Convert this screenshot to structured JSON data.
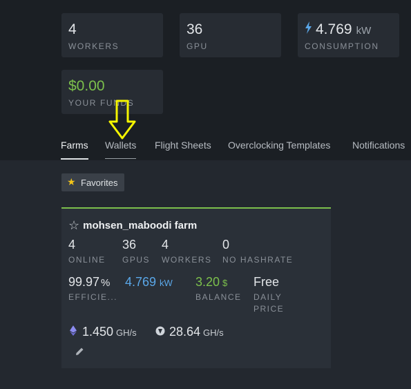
{
  "stats": [
    {
      "value": "4",
      "label": "WORKERS"
    },
    {
      "value": "36",
      "label": "GPU"
    },
    {
      "icon": "lightning-icon",
      "value": "4.769",
      "unit": "kW",
      "label": "CONSUMPTION"
    },
    {
      "value": "$0.00",
      "label": "YOUR FUNDS",
      "value_color": "#7cc04c"
    }
  ],
  "tabs": [
    {
      "label": "Farms",
      "active": true
    },
    {
      "label": "Wallets",
      "hover": true
    },
    {
      "label": "Flight Sheets"
    },
    {
      "label": "Overclocking Templates"
    },
    {
      "label": "Notifications"
    }
  ],
  "favorites_button": "Favorites",
  "farm": {
    "name": "mohsen_maboodi farm",
    "metrics": [
      {
        "value": "4",
        "label": "ONLINE"
      },
      {
        "value": "36",
        "label": "GPUS"
      },
      {
        "value": "4",
        "label": "WORKERS"
      },
      {
        "value": "0",
        "label": "NO HASHRATE"
      }
    ],
    "efficiency": {
      "value": "99.97",
      "unit": "%",
      "label": "EFFICIE..."
    },
    "power": {
      "value": "4.769",
      "unit": "kW"
    },
    "balance": {
      "value": "3.20",
      "unit": "$",
      "label": "BALANCE"
    },
    "daily_price": {
      "value": "Free",
      "label_line1": "DAILY",
      "label_line2": "PRICE"
    },
    "hashrates": [
      {
        "coin_icon": "ethereum-icon",
        "value": "1.450",
        "unit": "GH/s"
      },
      {
        "coin_icon": "ravencoin-icon",
        "value": "28.64",
        "unit": "GH/s"
      }
    ]
  },
  "colors": {
    "accent_green": "#7cc04c",
    "accent_blue": "#5aa7e8",
    "star_yellow": "#f3c51a",
    "arrow_yellow": "#f5f500"
  }
}
